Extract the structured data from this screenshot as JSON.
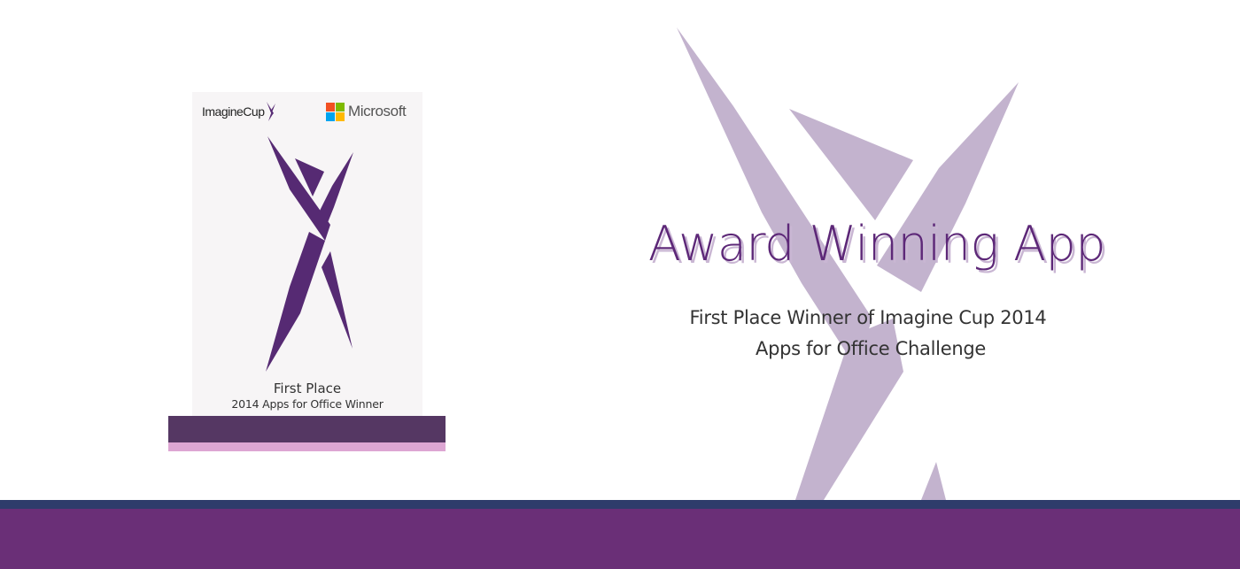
{
  "award": {
    "headline": "Award Winning App",
    "subtitle_line1": "First Place Winner of Imagine Cup 2014",
    "subtitle_line2": "Apps for Office Challenge"
  },
  "trophy": {
    "brand_left": "ImagineCup",
    "brand_right": "Microsoft",
    "title": "First Place",
    "subtitle": "2014 Apps for Office Winner"
  },
  "colors": {
    "purple_dark": "#5d2878",
    "purple_figure": "#562a73",
    "watermark": "#c3b3ce",
    "footer_band": "#6a2f77",
    "footer_line": "#2e3c6b",
    "trophy_base": "#553763",
    "trophy_strip": "#dda6d3",
    "ms_red": "#f25022",
    "ms_green": "#7fba00",
    "ms_blue": "#00a4ef",
    "ms_yellow": "#ffb900"
  },
  "icons": {
    "watermark": "imagine-cup-figure-icon",
    "trophy_figure": "imagine-cup-figure-icon",
    "microsoft_logo": "microsoft-logo-icon"
  }
}
